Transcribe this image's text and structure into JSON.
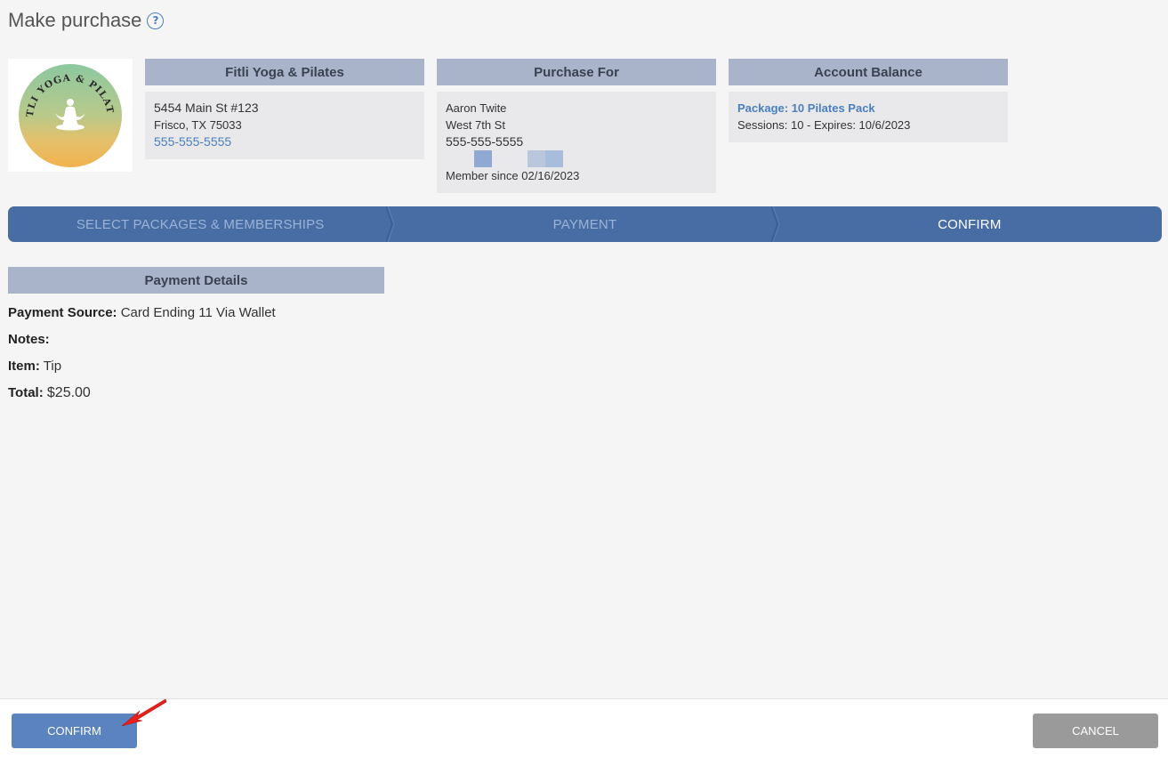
{
  "page": {
    "title": "Make purchase",
    "help_icon": "question-circle-icon"
  },
  "colors": {
    "accent": "#4a7fc0",
    "stepper_bg": "#486da4",
    "header_bg": "#a9b3c9",
    "confirm_btn": "#5a83bf",
    "cancel_btn": "#9a9a9a"
  },
  "logo": {
    "text_top": "FITLI YOGA & PILATES",
    "icon": "meditating-figure-icon"
  },
  "studio": {
    "title": "Fitli Yoga & Pilates",
    "address1": "5454 Main St #123",
    "address2": "Frisco, TX 75033",
    "phone": "555-555-5555"
  },
  "purchase_for": {
    "title": "Purchase For",
    "name": "Aaron Twite",
    "street": "West 7th St",
    "phone": "555-555-5555",
    "member_since": "Member since 02/16/2023"
  },
  "account_balance": {
    "title": "Account Balance",
    "package": "Package: 10 Pilates Pack",
    "sessions": "Sessions: 10 -  Expires: 10/6/2023"
  },
  "steps": [
    {
      "label": "SELECT PACKAGES & MEMBERSHIPS"
    },
    {
      "label": "PAYMENT"
    },
    {
      "label": "CONFIRM"
    }
  ],
  "payment_details": {
    "title": "Payment Details",
    "source_label": "Payment Source:",
    "source_value": "Card Ending 11 Via Wallet",
    "notes_label": "Notes:",
    "item_label": "Item:",
    "item_value": "Tip",
    "total_label": "Total:",
    "total_value": "$25.00"
  },
  "footer": {
    "confirm_label": "CONFIRM",
    "cancel_label": "CANCEL"
  }
}
